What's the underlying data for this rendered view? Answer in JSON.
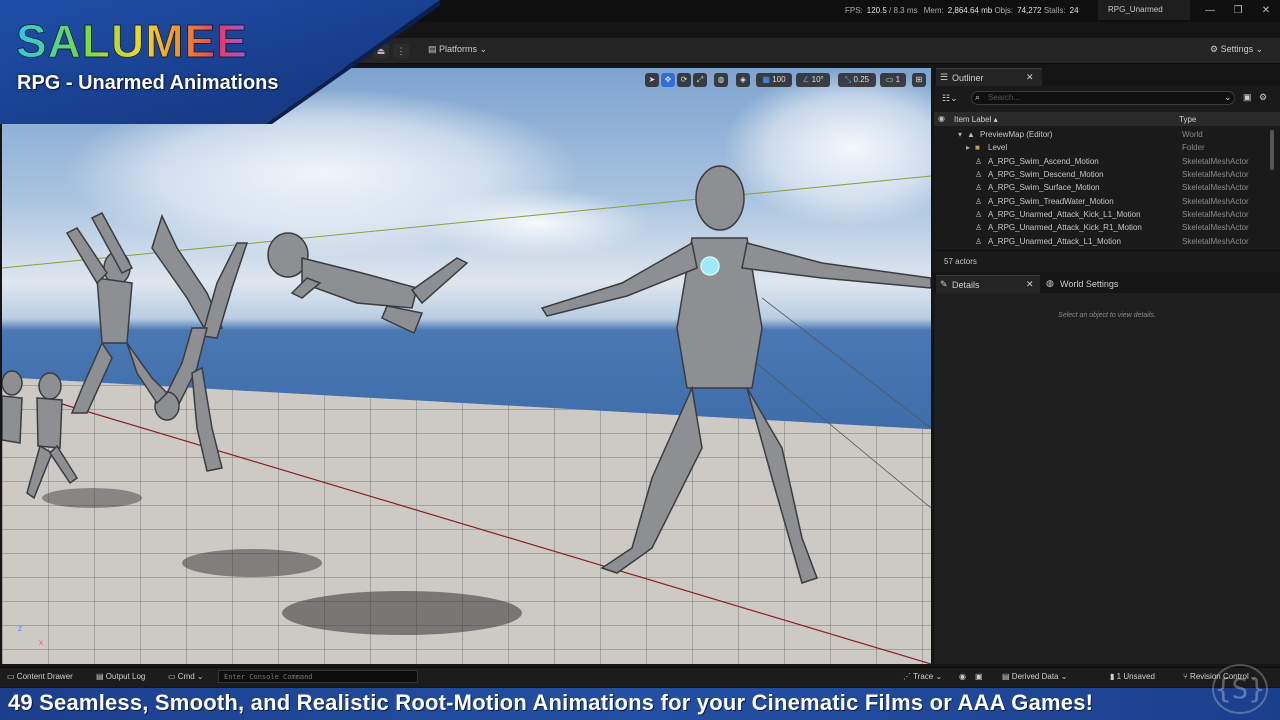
{
  "window": {
    "stats": {
      "fps_label": "FPS:",
      "fps": "120.5",
      "ms": "/ 8.3 ms",
      "mem_label": "Mem:",
      "mem": "2,864.64 mb",
      "objs_label": "Objs:",
      "objs": "74,272",
      "stalls_label": "Stalls:",
      "stalls": "24"
    },
    "tab_name": "RPG_Unarmed"
  },
  "toolbar": {
    "platforms_label": "Platforms",
    "settings_label": "Settings"
  },
  "viewport": {
    "grid_size": "100",
    "rotation_snap": "10°",
    "scale_snap": "0.25",
    "camera_speed": "1",
    "axis_z": "z",
    "axis_x": "x"
  },
  "logo": {
    "title": "SALUMEE",
    "subtitle": "RPG - Unarmed Animations"
  },
  "outliner": {
    "tab_label": "Outliner",
    "search_placeholder": "Search...",
    "col_item_label": "Item Label ▴",
    "col_type": "Type",
    "rows": [
      {
        "label": "PreviewMap (Editor)",
        "type": "World"
      },
      {
        "label": "Level",
        "type": "Folder"
      },
      {
        "label": "A_RPG_Swim_Ascend_Motion",
        "type": "SkeletalMeshActor"
      },
      {
        "label": "A_RPG_Swim_Descend_Motion",
        "type": "SkeletalMeshActor"
      },
      {
        "label": "A_RPG_Swim_Surface_Motion",
        "type": "SkeletalMeshActor"
      },
      {
        "label": "A_RPG_Swim_TreadWater_Motion",
        "type": "SkeletalMeshActor"
      },
      {
        "label": "A_RPG_Unarmed_Attack_Kick_L1_Motion",
        "type": "SkeletalMeshActor"
      },
      {
        "label": "A_RPG_Unarmed_Attack_Kick_R1_Motion",
        "type": "SkeletalMeshActor"
      },
      {
        "label": "A_RPG_Unarmed_Attack_L1_Motion",
        "type": "SkeletalMeshActor"
      }
    ],
    "actor_count": "57 actors"
  },
  "details": {
    "tab_label": "Details",
    "world_settings_label": "World Settings",
    "empty_message": "Select an object to view details."
  },
  "bottombar": {
    "content_drawer": "Content Drawer",
    "output_log": "Output Log",
    "cmd": "Cmd",
    "console_placeholder": "Enter Console Command",
    "trace": "Trace",
    "derived_data": "Derived Data",
    "unsaved": "1 Unsaved",
    "revision_control": "Revision Control"
  },
  "promo": {
    "text": "49 Seamless, Smooth, and Realistic Root-Motion Animations for your Cinematic Films or AAA Games!"
  },
  "colors": {
    "accent": "#2f6fd6",
    "promo_bg": "#2350a4"
  }
}
